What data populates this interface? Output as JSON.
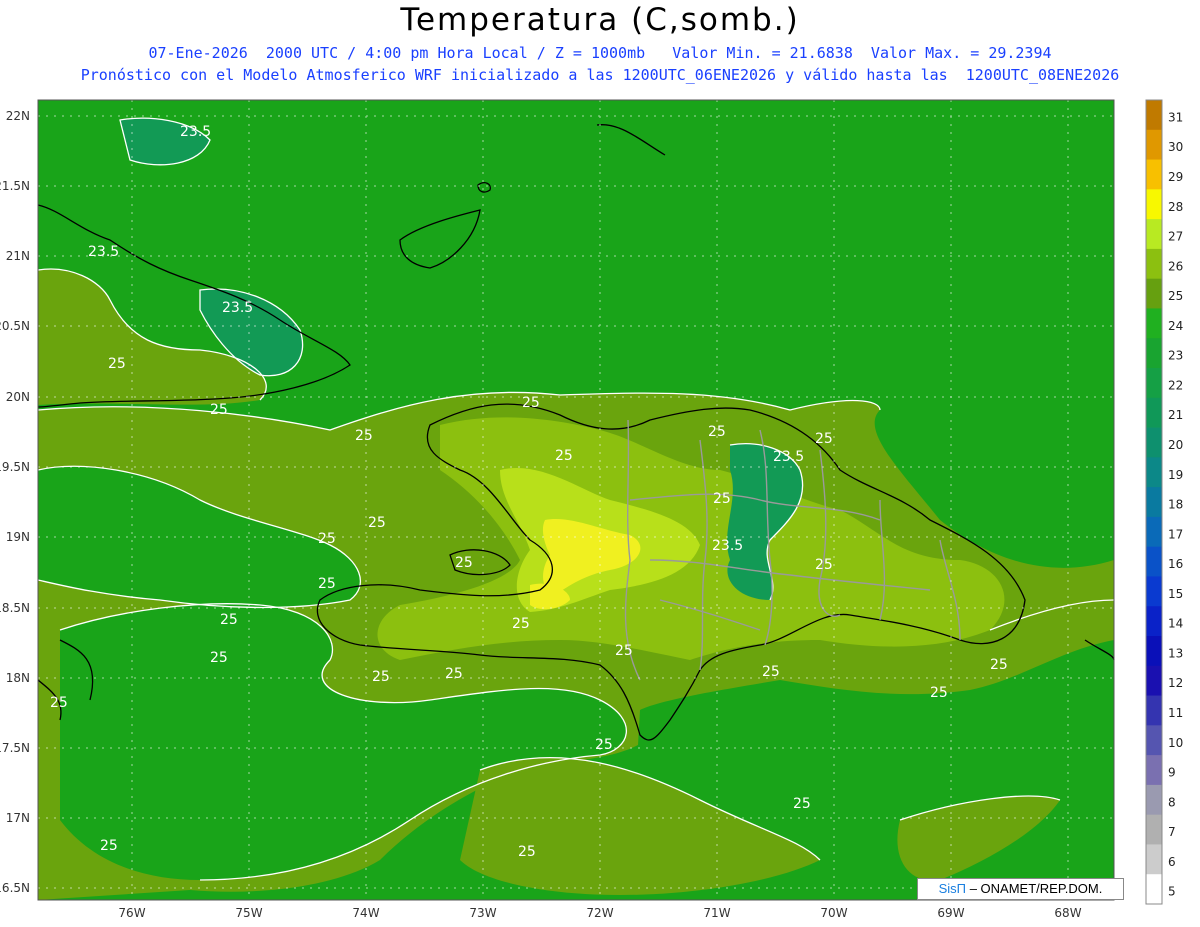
{
  "title": "Temperatura (C,somb.)",
  "subtitle_line1": "07-Ene-2026  2000 UTC / 4:00 pm Hora Local / Z = 1000mb   Valor Min. = 21.6838  Valor Max. = 29.2394",
  "subtitle_line2": "Pronóstico con el Modelo Atmosferico WRF inicializado a las 1200UTC_06ENE2026 y válido hasta las  1200UTC_08ENE2026",
  "credit": {
    "sis": "SisΠ",
    "rest": " –  ONAMET/REP.DOM."
  },
  "map": {
    "lon_range": [
      -76.7,
      -67.6
    ],
    "lat_range": [
      16.4,
      22.1
    ],
    "lat_ticks": [
      "22N",
      "21.5N",
      "21N",
      "20.5N",
      "20N",
      "19.5N",
      "19N",
      "18.5N",
      "18N",
      "17.5N",
      "17N",
      "16.5N"
    ],
    "lon_ticks": [
      "76W",
      "75W",
      "74W",
      "73W",
      "72W",
      "71W",
      "70W",
      "69W",
      "68W"
    ],
    "contour_labels": [
      "23.5",
      "23.5",
      "23.5",
      "25",
      "25",
      "25",
      "25",
      "25",
      "25",
      "25",
      "25",
      "25",
      "25",
      "25",
      "25",
      "25",
      "25",
      "25",
      "25",
      "25",
      "25",
      "25",
      "25",
      "25",
      "25",
      "25",
      "23.5",
      "23.5",
      "25",
      "25",
      "25",
      "25"
    ],
    "colors": {
      "sea": "#19a419",
      "level_25": "#6aa40d",
      "level_26": "#8cc00f",
      "level_27": "#b8e01a",
      "level_28": "#f0f020",
      "level_cool": "#129a55",
      "coast": "#000000",
      "borders": "#9a9a9a",
      "contour": "#ffffff"
    }
  },
  "colorbar": {
    "labels": [
      "31",
      "30",
      "29",
      "28",
      "27",
      "26",
      "25",
      "24",
      "23",
      "22",
      "21",
      "20",
      "19",
      "18",
      "17",
      "16",
      "15",
      "14",
      "13",
      "12",
      "11",
      "10",
      "9",
      "8",
      "7",
      "6",
      "5"
    ],
    "colors": [
      "#c07a00",
      "#e09800",
      "#f8c000",
      "#f8f800",
      "#b8ea22",
      "#8cc010",
      "#66a010",
      "#20b020",
      "#19a430",
      "#15a045",
      "#109858",
      "#0e906e",
      "#0c8888",
      "#0a7aa0",
      "#0a6ab8",
      "#0a52c8",
      "#0a3ad0",
      "#0a22c8",
      "#0a10b8",
      "#1a10b0",
      "#3434b0",
      "#5555b0",
      "#7a70b0",
      "#9a9ab0",
      "#b0b0b0",
      "#cccccc",
      "#ffffff"
    ]
  }
}
